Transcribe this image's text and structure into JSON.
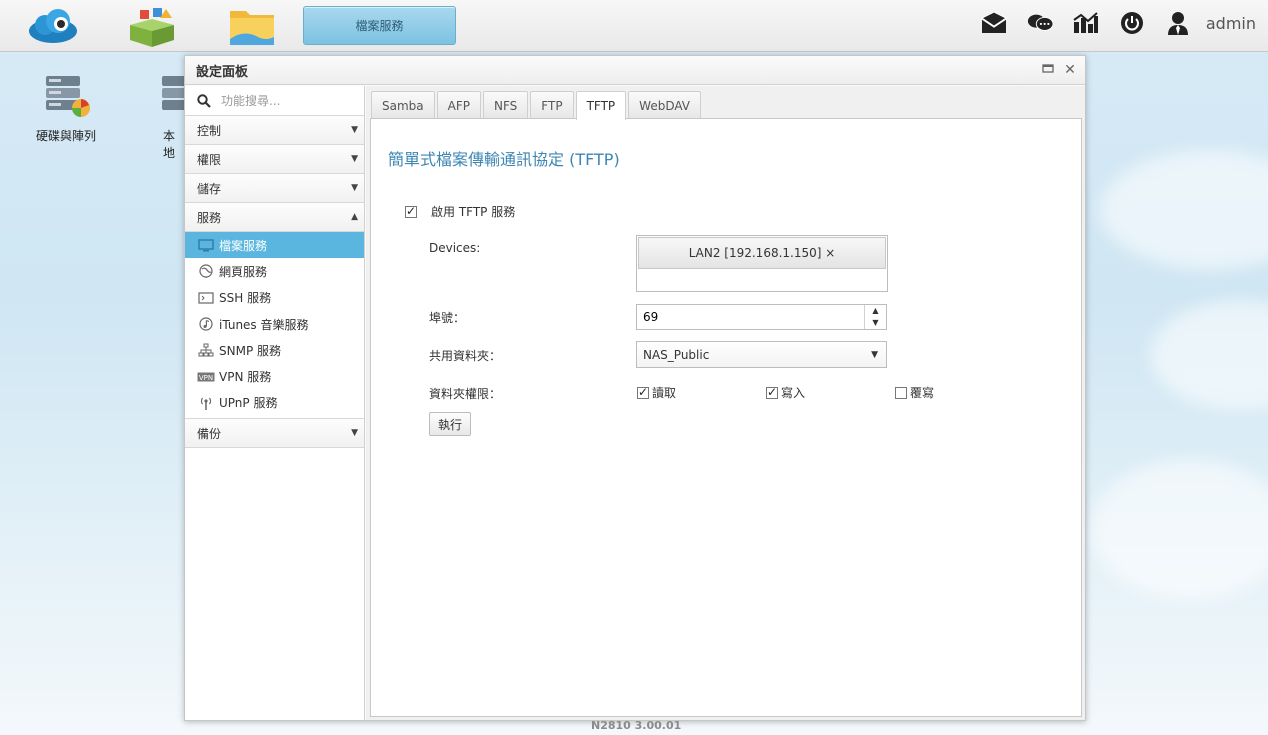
{
  "taskbar": {
    "running_app": "檔案服務",
    "user": "admin"
  },
  "desktop": {
    "icons": [
      {
        "label": "硬碟與陣列"
      },
      {
        "label": "本地"
      }
    ]
  },
  "window": {
    "title": "設定面板"
  },
  "sidebar": {
    "search_placeholder": "功能搜尋...",
    "categories": {
      "control": "控制",
      "permission": "權限",
      "storage": "儲存",
      "service": "服務",
      "backup": "備份"
    },
    "services": [
      {
        "label": "檔案服務"
      },
      {
        "label": "網頁服務"
      },
      {
        "label": "SSH 服務"
      },
      {
        "label": "iTunes 音樂服務"
      },
      {
        "label": "SNMP 服務"
      },
      {
        "label": "VPN 服務"
      },
      {
        "label": "UPnP 服務"
      }
    ]
  },
  "tabs": [
    "Samba",
    "AFP",
    "NFS",
    "FTP",
    "TFTP",
    "WebDAV"
  ],
  "tftp": {
    "title": "簡單式檔案傳輸通訊協定 (TFTP)",
    "enable_label": "啟用 TFTP 服務",
    "devices_label": "Devices:",
    "device_tag": "LAN2 [192.168.1.150] ×",
    "port_label": "埠號：",
    "port_value": "69",
    "share_label": "共用資料夾：",
    "share_value": "NAS_Public",
    "perm_label": "資料夾權限：",
    "perm_read": "讀取",
    "perm_write": "寫入",
    "perm_overwrite": "覆寫",
    "run_button": "執行"
  },
  "footer": "N2810   3.00.01"
}
